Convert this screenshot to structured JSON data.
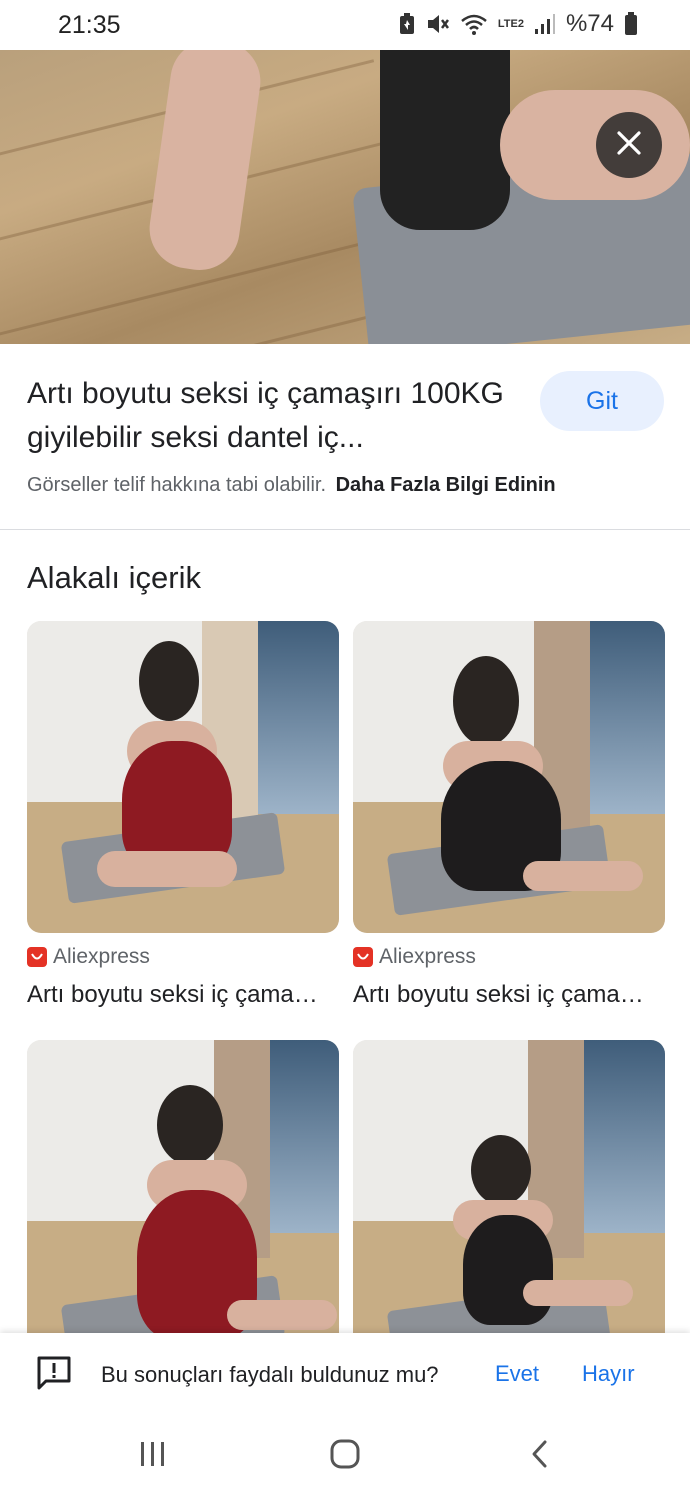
{
  "status_bar": {
    "time": "21:35",
    "battery": "%74",
    "network_label": "LTE2",
    "icons": [
      "battery-saver-icon",
      "mute-icon",
      "wifi-icon",
      "signal-icon",
      "battery-icon"
    ]
  },
  "viewer": {
    "close_icon": "close-icon",
    "result_title": "Artı boyutu seksi iç çamaşırı 100KG giyilebilir seksi dantel iç...",
    "go_button": "Git",
    "copyright_text": "Görseller telif hakkına tabi olabilir.",
    "learn_more": "Daha Fazla Bilgi Edinin"
  },
  "related": {
    "heading": "Alakalı içerik",
    "items": [
      {
        "source": "Aliexpress",
        "title": "Artı boyutu seksi iç çamaşırı",
        "dress_color": "#8e1a22"
      },
      {
        "source": "Aliexpress",
        "title": "Artı boyutu seksi iç çamaşırı",
        "dress_color": "#1e1c1d"
      },
      {
        "source": "",
        "title": "",
        "dress_color": "#8e1a22"
      },
      {
        "source": "",
        "title": "",
        "dress_color": "#1e1c1d"
      }
    ]
  },
  "feedback": {
    "question": "Bu sonuçları faydalı buldunuz mu?",
    "yes": "Evet",
    "no": "Hayır"
  },
  "navigation": {
    "buttons": [
      "recent-apps-icon",
      "home-icon",
      "back-icon"
    ]
  },
  "colors": {
    "accent": "#1a73e8",
    "button_bg": "#e8f0fe",
    "source_brand": "#e43225"
  }
}
